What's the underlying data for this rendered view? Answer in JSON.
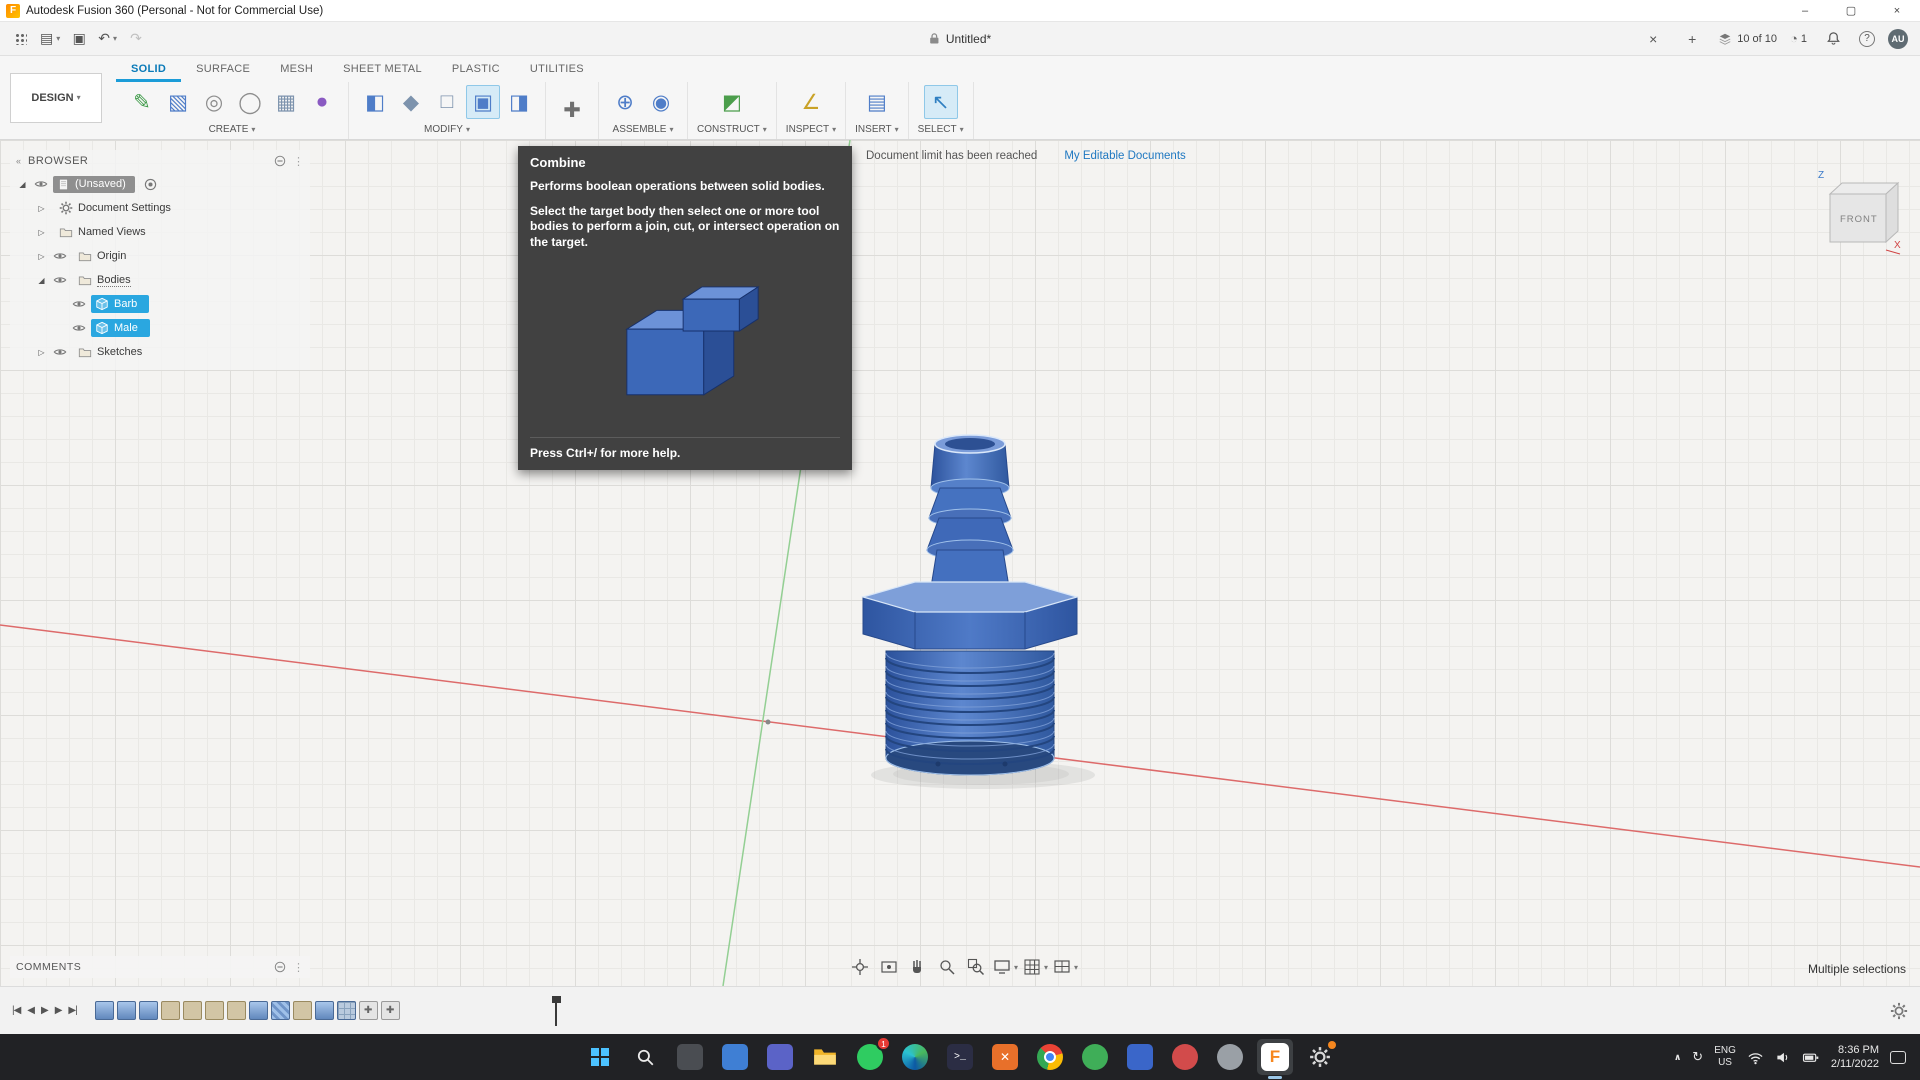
{
  "colors": {
    "accent_blue": "#1b9cd8",
    "selection_blue": "#2aa7e0",
    "model_blue": "#3a66b5",
    "axis_red": "#dd6a6a",
    "axis_green": "#93cf93"
  },
  "title_bar": {
    "title": "Autodesk Fusion 360 (Personal - Not for Commercial Use)",
    "minimize": "–",
    "restore": "▢",
    "close": "×"
  },
  "app_bar": {
    "undo": "↶",
    "redo": "↷",
    "document_tab": "Untitled*",
    "tab_close": "×",
    "tab_add": "+",
    "job_status": "10 of 10",
    "clock_badge": "1",
    "help": "?",
    "avatar": "AU"
  },
  "ribbon": {
    "design_menu": "DESIGN",
    "tabs": [
      {
        "label": "SOLID",
        "active": true
      },
      {
        "label": "SURFACE",
        "active": false
      },
      {
        "label": "MESH",
        "active": false
      },
      {
        "label": "SHEET METAL",
        "active": false
      },
      {
        "label": "PLASTIC",
        "active": false
      },
      {
        "label": "UTILITIES",
        "active": false
      }
    ],
    "groups": [
      {
        "label": "CREATE",
        "icons": [
          "create-sketch-icon",
          "box-primitive-icon",
          "revolve-icon",
          "swe ep-icon",
          "rectangular-pattern-icon",
          "create-form-icon"
        ]
      },
      {
        "label": "MODIFY",
        "icons": [
          "press-pull-icon",
          "fillet-icon",
          "shell-icon",
          "combine-icon",
          "offset-face-icon"
        ]
      },
      {
        "label": "",
        "icons": [
          "move-copy-icon"
        ]
      },
      {
        "label": "ASSEMBLE",
        "icons": [
          "new-component-icon",
          "joint-icon"
        ]
      },
      {
        "label": "CONSTRUCT",
        "icons": [
          "construction-plane-icon"
        ]
      },
      {
        "label": "INSPECT",
        "icons": [
          "measure-icon"
        ]
      },
      {
        "label": "INSERT",
        "icons": [
          "insert-image-icon"
        ]
      },
      {
        "label": "SELECT",
        "icons": [
          "select-icon"
        ]
      }
    ],
    "active_icons": [
      "combine-icon",
      "select-icon"
    ]
  },
  "browser": {
    "header": "BROWSER",
    "rows": [
      {
        "depth": 0,
        "expander": "expanded",
        "eye": true,
        "icon": "doc",
        "label": "(Unsaved)",
        "root": true,
        "radio": true
      },
      {
        "depth": 1,
        "expander": "collapsed",
        "icon": "gear",
        "label": "Document Settings"
      },
      {
        "depth": 1,
        "expander": "collapsed",
        "icon": "folder",
        "label": "Named Views"
      },
      {
        "depth": 1,
        "expander": "collapsed",
        "eye": true,
        "icon": "folder",
        "label": "Origin"
      },
      {
        "depth": 1,
        "expander": "expanded",
        "eye": true,
        "icon": "folder",
        "label": "Bodies",
        "dotted": true
      },
      {
        "depth": 2,
        "eye": true,
        "icon": "body",
        "label": "Barb",
        "selected": true
      },
      {
        "depth": 2,
        "eye": true,
        "icon": "body",
        "label": "Male",
        "selected": true
      },
      {
        "depth": 1,
        "expander": "collapsed",
        "eye": true,
        "icon": "folder",
        "label": "Sketches"
      }
    ]
  },
  "tooltip": {
    "title": "Combine",
    "summary": "Performs boolean operations between solid bodies.",
    "detail": "Select the target body then select one or more tool bodies to perform a join, cut, or intersect operation on the target.",
    "footer": "Press Ctrl+/ for more help."
  },
  "canvas": {
    "notice": "Document limit has been reached",
    "notice_link": "My Editable Documents",
    "selection_status": "Multiple selections",
    "viewcube_front": "FRONT",
    "axis_z": "Z",
    "axis_x": "X"
  },
  "comments": {
    "header": "COMMENTS"
  },
  "timeline": {
    "playback": [
      {
        "glyph": "|◀",
        "name": "go-to-start-button"
      },
      {
        "glyph": "◀",
        "name": "step-back-button"
      },
      {
        "glyph": "▶",
        "name": "play-button"
      },
      {
        "glyph": "▶",
        "name": "step-forward-button"
      },
      {
        "glyph": "▶|",
        "name": "go-to-end-button"
      }
    ],
    "features": [
      "extrude",
      "extrude",
      "extrude",
      "sketch",
      "sketch",
      "sketch",
      "sketch",
      "extrude",
      "thread",
      "sketch",
      "extrude",
      "pattern",
      "move",
      "move"
    ]
  },
  "nav_bar": {
    "icons": [
      "orbit-icon",
      "look-at-icon",
      "pan-icon",
      "zoom-icon",
      "fit-icon",
      "display-settings-icon",
      "grid-display-icon",
      "viewports-icon"
    ]
  },
  "taskbar": {
    "icons": [
      {
        "name": "start-button",
        "kind": "start"
      },
      {
        "name": "search-button",
        "kind": "search"
      },
      {
        "name": "task-view-app-icon",
        "kind": "square",
        "color": "#4a4d52"
      },
      {
        "name": "mail-app-icon",
        "kind": "square",
        "color": "#3f7fd4"
      },
      {
        "name": "teams-app-icon",
        "kind": "square",
        "color": "#5b63c7"
      },
      {
        "name": "file-explorer-icon",
        "kind": "folder"
      },
      {
        "name": "whatsapp-icon",
        "kind": "circle",
        "color": "#2fcc61",
        "badge": "1"
      },
      {
        "name": "edge-browser-icon",
        "kind": "edge"
      },
      {
        "name": "terminal-app-icon",
        "kind": "terminal"
      },
      {
        "name": "orange-x-app-icon",
        "kind": "square",
        "color": "#e8702a",
        "glyph": "✕"
      },
      {
        "name": "chrome-browser-icon",
        "kind": "chrome"
      },
      {
        "name": "green-app-icon",
        "kind": "circle",
        "color": "#3fae58"
      },
      {
        "name": "blue-app-icon",
        "kind": "square",
        "color": "#3a66c9"
      },
      {
        "name": "red-app-icon",
        "kind": "circle",
        "color": "#d24b4b"
      },
      {
        "name": "gray-app-icon",
        "kind": "circle",
        "color": "#9aa0a6"
      },
      {
        "name": "fusion-360-app-icon",
        "kind": "fusion",
        "active": true
      },
      {
        "name": "settings-gear-icon",
        "kind": "gear",
        "badge_dot": true
      }
    ],
    "tray": {
      "chevron": "∧",
      "sync": "↻",
      "lang_line1": "ENG",
      "lang_line2": "US",
      "time": "8:36 PM",
      "date": "2/11/2022"
    }
  }
}
